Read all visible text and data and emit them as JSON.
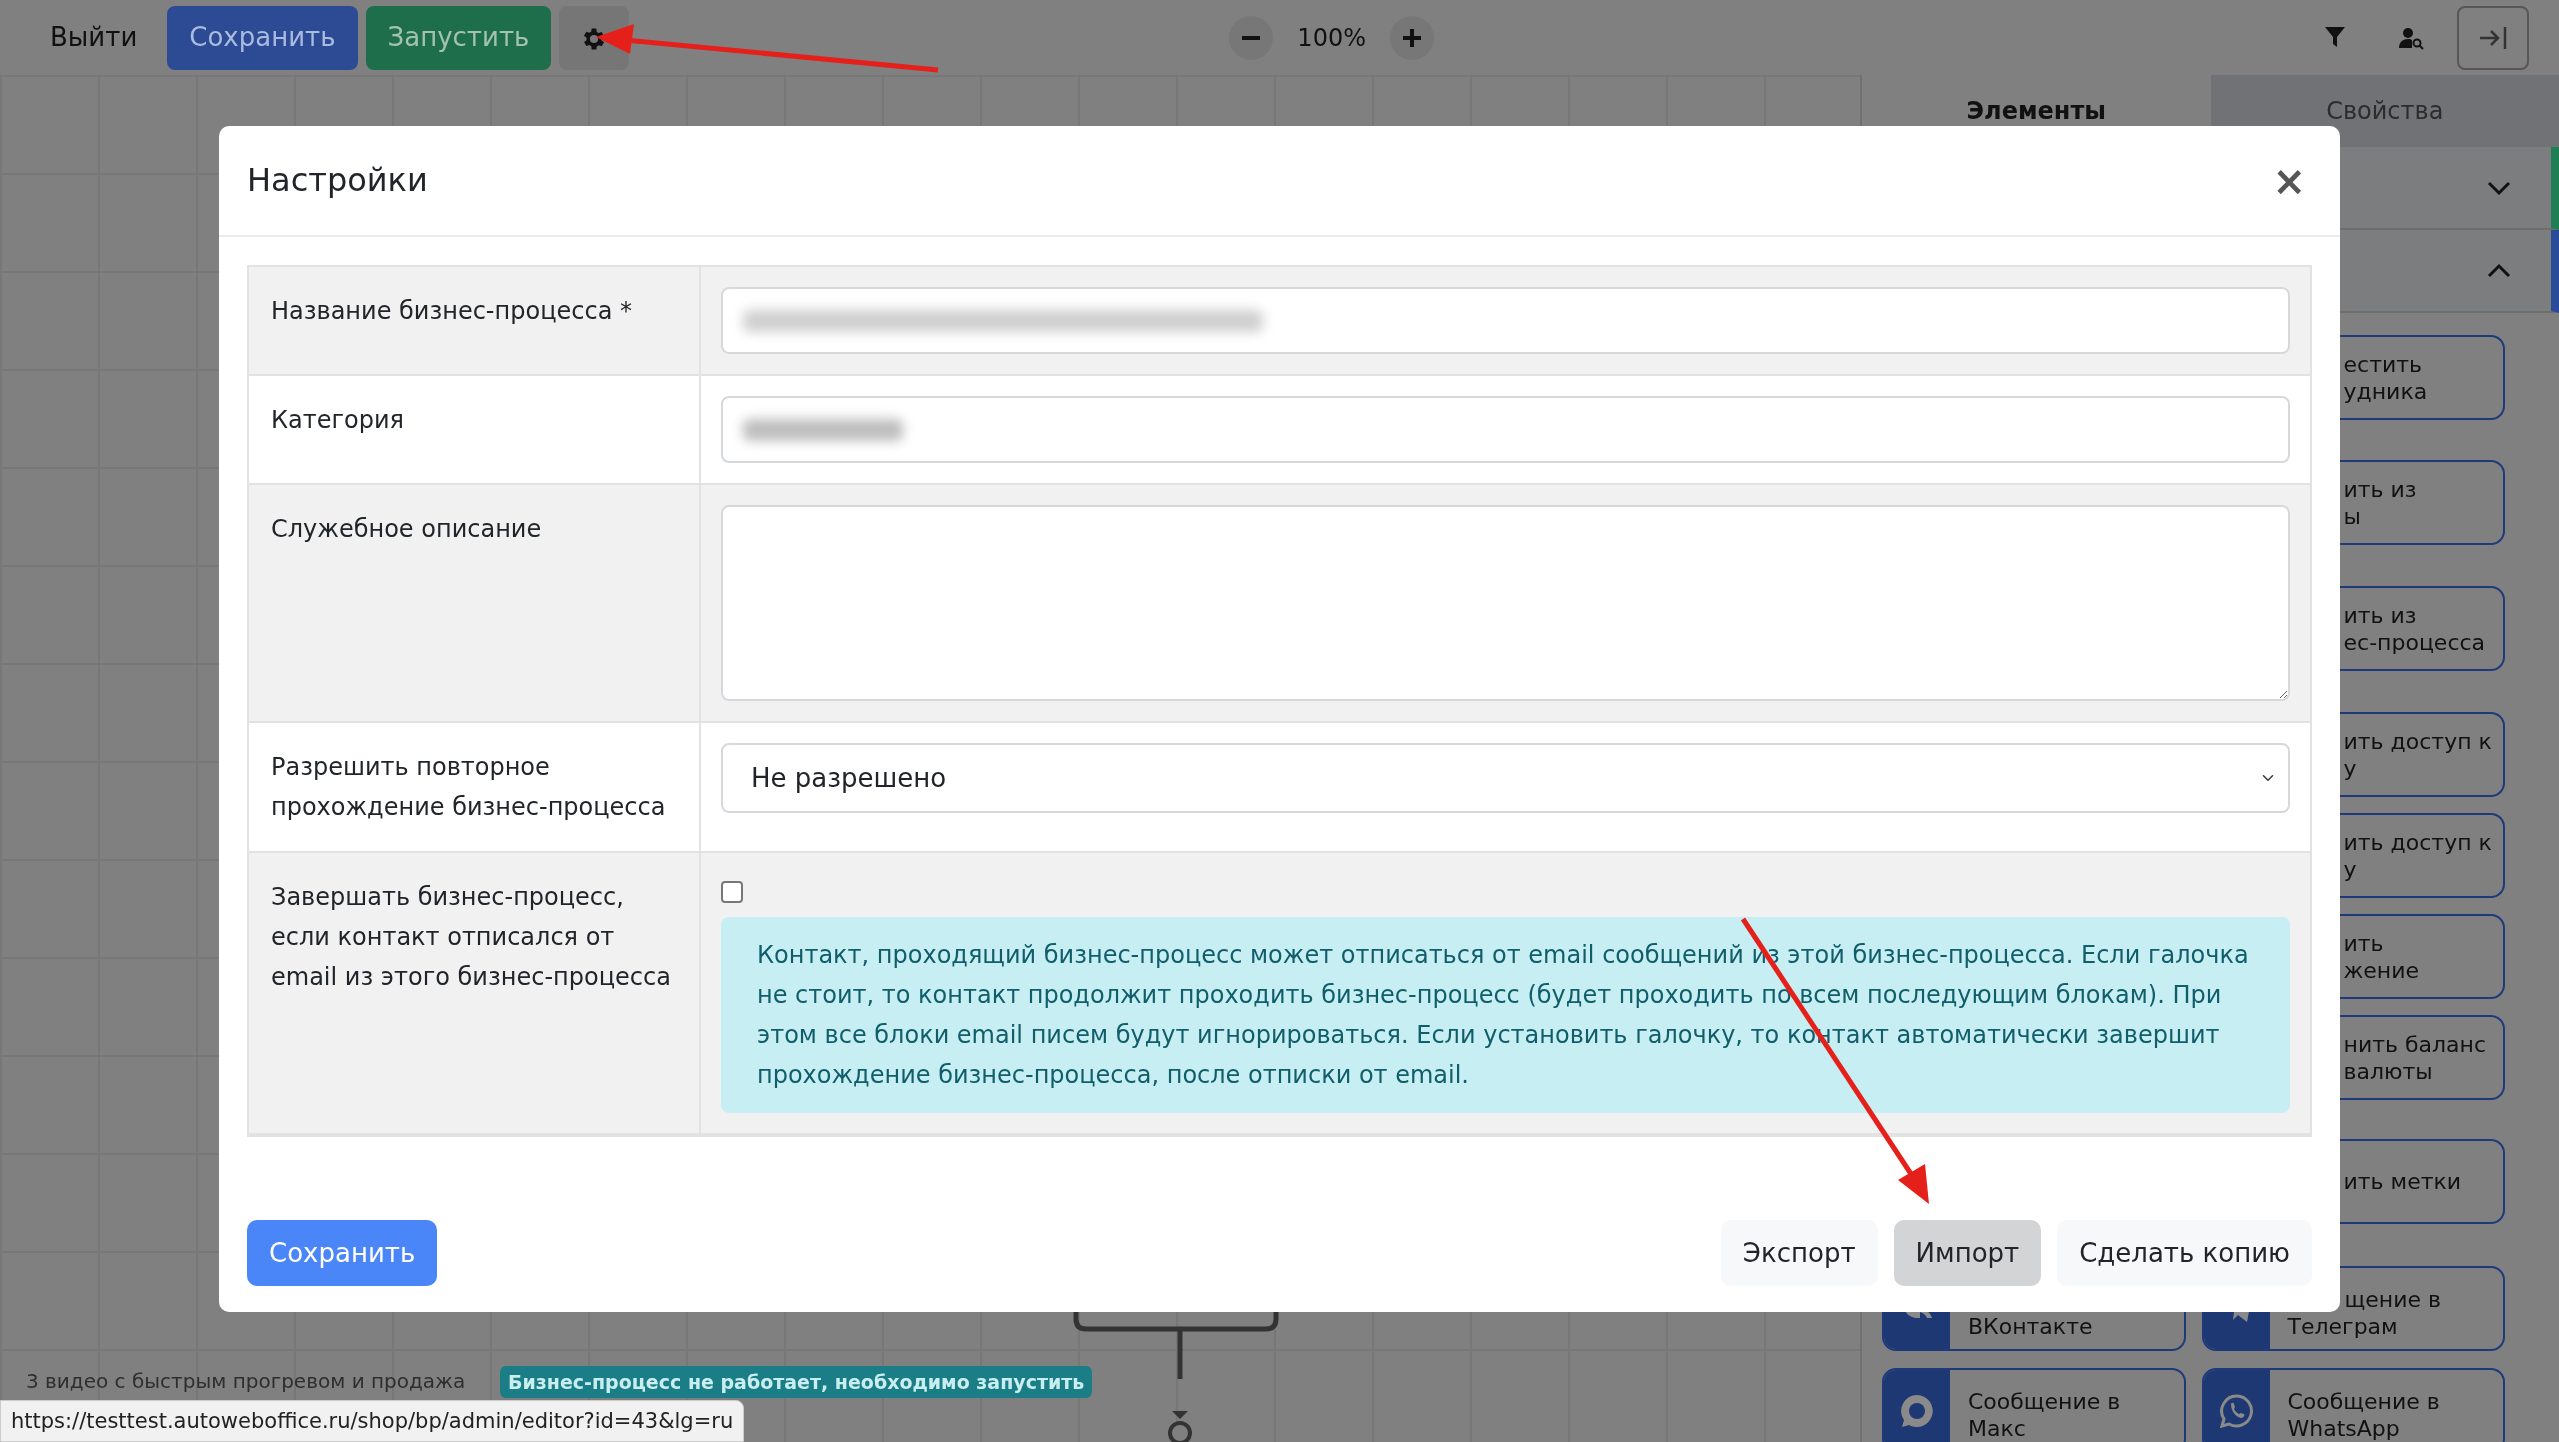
{
  "toolbar": {
    "exit": "Выйти",
    "save": "Сохранить",
    "run": "Запустить",
    "zoom": "100%"
  },
  "panel": {
    "tabs": [
      {
        "label": "Элементы",
        "selected": true
      },
      {
        "label": "Свойства",
        "selected": false
      }
    ],
    "sections": [
      {
        "expanded": false,
        "color": "#1e7f55"
      },
      {
        "expanded": true,
        "color": "#2a4a9a"
      }
    ],
    "right_column": [
      {
        "kind": "plain",
        "lines": [
          "естить",
          "удника"
        ]
      },
      {
        "kind": "plain",
        "lines": [
          "ить из",
          "ы"
        ]
      },
      {
        "kind": "plain",
        "lines": [
          "ить из",
          "ес-процесса"
        ]
      },
      {
        "kind": "plain",
        "lines": [
          "ить доступ к",
          "у"
        ]
      },
      {
        "kind": "plain",
        "lines": [
          "ить доступ к",
          "у"
        ]
      },
      {
        "kind": "plain",
        "lines": [
          "ить",
          "жение"
        ]
      },
      {
        "kind": "plain",
        "lines": [
          "нить баланс",
          "валюты"
        ]
      },
      {
        "kind": "plain",
        "lines": [
          "ить метки"
        ]
      },
      {
        "kind": "telegram",
        "lines": [
          "щение в",
          "Телеграм"
        ]
      },
      {
        "kind": "whatsapp",
        "lines": [
          "Сообщение в",
          "WhatsApp"
        ]
      }
    ],
    "left_column": [
      {
        "kind": "vk",
        "lines": [
          "ВКонтакте"
        ]
      },
      {
        "kind": "max",
        "lines": [
          "Сообщение в",
          "Макс"
        ]
      }
    ]
  },
  "canvas": {
    "process_name": "3 видео с быстрым прогревом и продажа",
    "status_badge": "Бизнес-процесс не работает, необходимо запустить"
  },
  "settings_modal": {
    "title": "Настройки",
    "close": "×",
    "fields": [
      {
        "kind": "text",
        "label": "Название бизнес-процесса *",
        "blurred": true
      },
      {
        "kind": "text",
        "label": "Категория",
        "blurred": true
      },
      {
        "kind": "textarea",
        "label": "Служебное описание"
      },
      {
        "kind": "select",
        "label": "Разрешить повторное прохождение бизнес-процесса",
        "value": "Не разрешено"
      },
      {
        "kind": "checkbox",
        "label": "Завершать бизнес-процесс, если контакт отписался от email из этого бизнес-процесса",
        "checked": false,
        "note": "Контакт, проходящий бизнес-процесс может отписаться от email сообщений из этой бизнес-процесса. Если галочка не стоит, то контакт продолжит проходить бизнес-процесс (будет проходить по всем последующим блокам). При этом все блоки email писем будут игнорироваться. Если установить галочку, то контакт автоматически завершит прохождение бизнес-процесса, после отписки от email."
      }
    ],
    "save": "Сохранить",
    "actions": [
      {
        "label": "Экспорт",
        "highlighted": false
      },
      {
        "label": "Импорт",
        "highlighted": true
      },
      {
        "label": "Сделать копию",
        "highlighted": false
      }
    ]
  },
  "status_url": "https://testtest.autoweboffice.ru/shop/bp/admin/editor?id=43&lg=ru"
}
